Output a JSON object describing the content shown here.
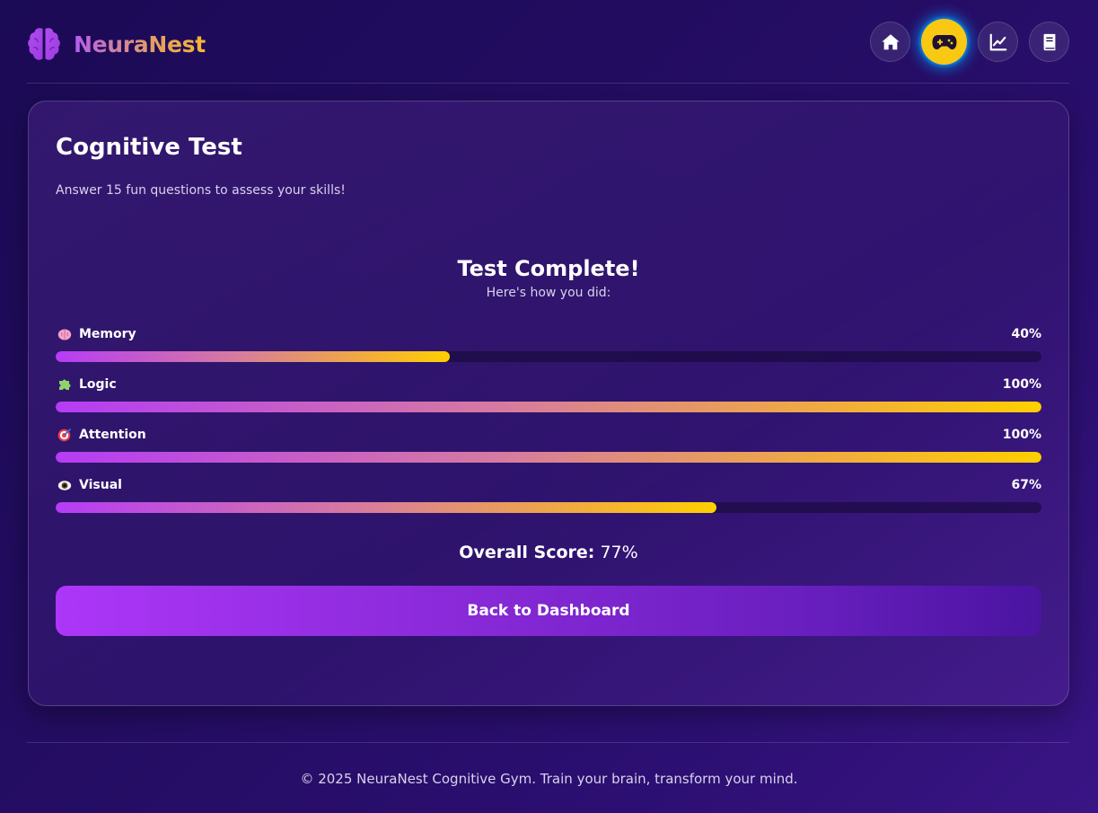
{
  "brand": {
    "name": "NeuraNest",
    "logo_icon": "brain-icon",
    "gradient": [
      "#b55cf0",
      "#f7b733"
    ]
  },
  "nav": {
    "items": [
      {
        "icon": "home-icon",
        "active": false
      },
      {
        "icon": "gamepad-icon",
        "active": true
      },
      {
        "icon": "chart-icon",
        "active": false
      },
      {
        "icon": "book-icon",
        "active": false
      }
    ],
    "active_color": "#f9c812"
  },
  "card": {
    "title": "Cognitive Test",
    "subtitle": "Answer 15 fun questions to assess your skills!"
  },
  "results": {
    "title": "Test Complete!",
    "subtitle": "Here's how you did:",
    "skills": [
      {
        "icon": "brain-icon",
        "label": "Memory",
        "value_text": "40%",
        "percent": 40
      },
      {
        "icon": "puzzle-icon",
        "label": "Logic",
        "value_text": "100%",
        "percent": 100
      },
      {
        "icon": "target-icon",
        "label": "Attention",
        "value_text": "100%",
        "percent": 100
      },
      {
        "icon": "eye-icon",
        "label": "Visual",
        "value_text": "67%",
        "percent": 67
      }
    ],
    "overall_label": "Overall Score:",
    "overall_value": "77%",
    "back_button": "Back to Dashboard"
  },
  "footer": {
    "text": "© 2025 NeuraNest Cognitive Gym. Train your brain, transform your mind."
  },
  "colors": {
    "background": "#240d63",
    "progress_start": "#b53cf5",
    "progress_end": "#ffd000"
  }
}
